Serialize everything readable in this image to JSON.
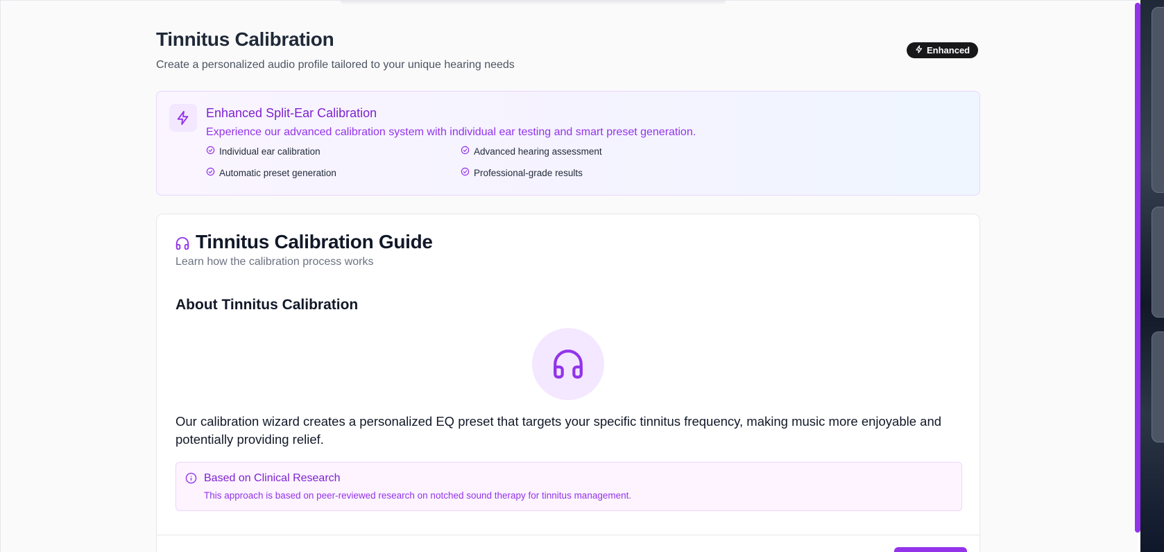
{
  "header": {
    "title": "Tinnitus Calibration",
    "subtitle": "Create a personalized audio profile tailored to your unique hearing needs",
    "badge": "Enhanced"
  },
  "promo": {
    "icon": "zap-icon",
    "title": "Enhanced Split-Ear Calibration",
    "description": "Experience our advanced calibration system with individual ear testing and smart preset generation.",
    "features": [
      "Individual ear calibration",
      "Advanced hearing assessment",
      "Automatic preset generation",
      "Professional-grade results"
    ]
  },
  "guide": {
    "icon": "headphones-icon",
    "title": "Tinnitus Calibration Guide",
    "subtitle": "Learn how the calibration process works",
    "about_title": "About Tinnitus Calibration",
    "body": "Our calibration wizard creates a personalized EQ preset that targets your specific tinnitus frequency, making music more enjoyable and potentially providing relief.",
    "research": {
      "icon": "info-icon",
      "title": "Based on Clinical Research",
      "description": "This approach is based on peer-reviewed research on notched sound therapy for tinnitus management."
    }
  },
  "colors": {
    "accent": "#9333ea",
    "accent_dark": "#7e22ce",
    "accent_light": "#f3e8ff",
    "badge_bg": "#18181b"
  }
}
